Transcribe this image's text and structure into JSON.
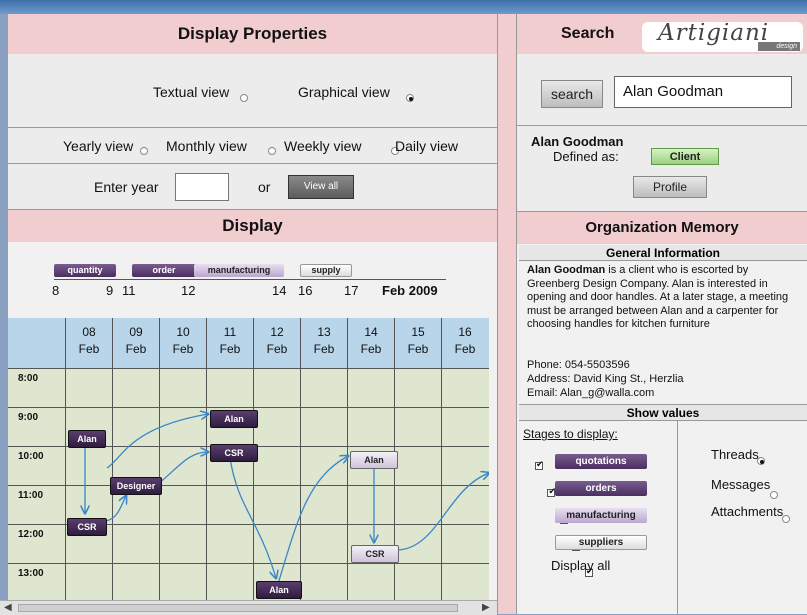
{
  "left": {
    "display_properties_title": "Display Properties",
    "textual_view": "Textual view",
    "graphical_view": "Graphical view",
    "yearly_view": "Yearly view",
    "monthly_view": "Monthly view",
    "weekly_view": "Weekly view",
    "daily_view": "Daily view",
    "enter_year": "Enter year",
    "or": "or",
    "view_all": "View all",
    "display_title": "Display"
  },
  "timeline": {
    "tags": [
      "quantity",
      "order",
      "manufacturing",
      "supply"
    ],
    "ticks": [
      "8",
      "9",
      "11",
      "12",
      "14",
      "16",
      "17"
    ],
    "month": "Feb 2009"
  },
  "calendar": {
    "days": [
      {
        "num": "08",
        "mon": "Feb"
      },
      {
        "num": "09",
        "mon": "Feb"
      },
      {
        "num": "10",
        "mon": "Feb"
      },
      {
        "num": "11",
        "mon": "Feb"
      },
      {
        "num": "12",
        "mon": "Feb"
      },
      {
        "num": "13",
        "mon": "Feb"
      },
      {
        "num": "14",
        "mon": "Feb"
      },
      {
        "num": "15",
        "mon": "Feb"
      },
      {
        "num": "16",
        "mon": "Feb"
      }
    ],
    "times": [
      "8:00",
      "9:00",
      "10:00",
      "11:00",
      "12:00",
      "13:00"
    ],
    "events": [
      "Alan",
      "CSR",
      "Designer",
      "Alan",
      "CSR",
      "Alan",
      "CSR",
      "Alan"
    ]
  },
  "right": {
    "search_title": "Search",
    "logo_text": "Artigiani",
    "logo_sub": "design",
    "search_button": "search",
    "search_value": "Alan Goodman",
    "person_name": "Alan Goodman",
    "defined_as": "Defined as:",
    "role": "Client",
    "profile_button": "Profile",
    "org_memory_title": "Organization Memory",
    "general_info_title": "General Information",
    "info_name": "Alan Goodman",
    "info_text": " is a client who is escorted by Greenberg Design Company. Alan is interested in opening and door handles. At a later stage, a meeting must be arranged between Alan and a carpenter for choosing handles for kitchen furniture",
    "phone": "Phone:   054-5503596",
    "address": "Address:  David King St., Herzlia",
    "email": "Email:   Alan_g@walla.com",
    "show_values_title": "Show values",
    "stages_label": "Stages to display:",
    "stages": [
      "quotations",
      "orders",
      "manufacturing",
      "suppliers"
    ],
    "display_all": "Display all",
    "options": [
      "Threads",
      "Messages",
      "Attachments"
    ]
  }
}
